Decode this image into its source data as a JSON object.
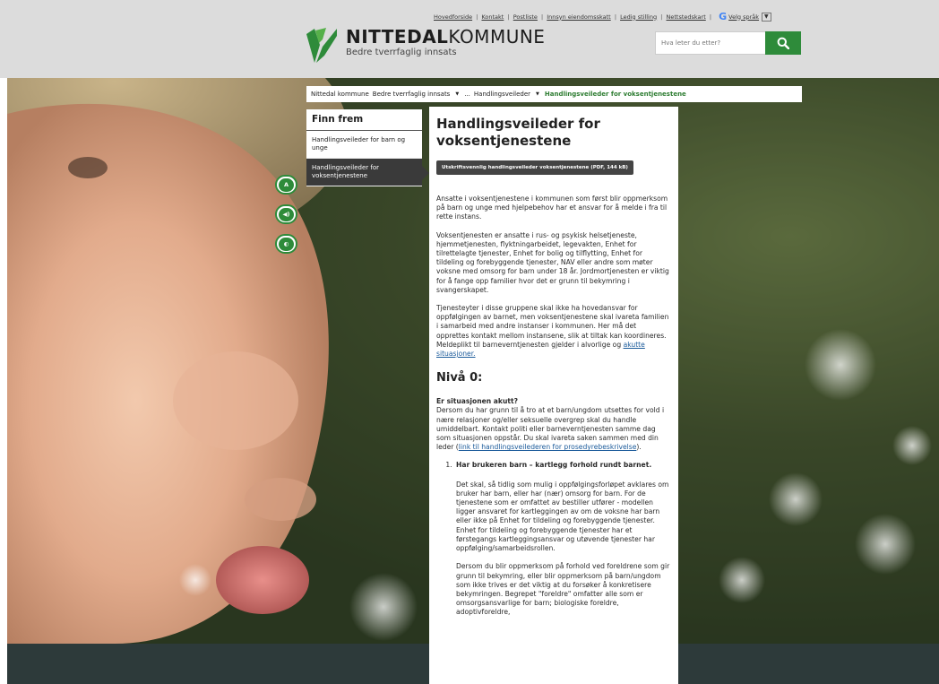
{
  "header": {
    "top_links": [
      "Hovedforside",
      "Kontakt",
      "Postliste",
      "Innsyn eiendomsskatt",
      "Ledig stilling",
      "Nettstedskart"
    ],
    "translate_label": "Velg språk",
    "translate_arrow": "▼",
    "brand_bold": "NITTEDAL",
    "brand_light": "KOMMUNE",
    "tagline": "Bedre tverrfaglig innsats",
    "search_placeholder": "Hva leter du etter?"
  },
  "breadcrumb": {
    "items": [
      "Nittedal kommune",
      "Bedre tverrfaglig innsats",
      "...",
      "Handlingsveileder"
    ],
    "current": "Handlingsveileder for voksentjenestene"
  },
  "sidenav": {
    "title": "Finn frem",
    "items": [
      "Handlingsveileder for barn og unge",
      "Handlingsveileder for voksentjenestene"
    ]
  },
  "tools": {
    "text_size": "A",
    "speaker": "◀)",
    "contrast": "◐"
  },
  "content": {
    "title": "Handlingsveileder for voksentjenestene",
    "pdf_button": "Utskriftsvennlig handlingsveileder voksentjenestene (PDF, 144 kB)",
    "p1": "Ansatte i voksentjenestene i kommunen som først blir oppmerksom på barn og unge med hjelpebehov har et ansvar for å melde i fra til rette instans.",
    "p2": "Voksentjenesten er ansatte i rus- og psykisk helsetjeneste, hjemmetjenesten, flyktningarbeidet, legevakten, Enhet for tilrettelagte tjenester, Enhet for bolig og tilflytting, Enhet for tildeling og forebyggende tjenester, NAV eller andre som møter voksne med omsorg for barn under 18 år. Jordmortjenesten er viktig for å fange opp familier hvor det er grunn til bekymring i svangerskapet.",
    "p3": "Tjenesteyter i disse gruppene skal ikke ha hovedansvar for oppfølgingen av barnet, men voksentjenestene skal ivareta familien i samarbeid med andre instanser i kommunen. Her må det opprettes kontakt mellom instansene, slik at tiltak kan koordineres. Meldeplikt til barneverntjenesten gjelder i alvorlige og",
    "p3_link": "akutte situasjoner.",
    "h2": "Nivå 0:",
    "sub": "Er situasjonen akutt?",
    "p4": "Dersom du har grunn til å tro at et barn/ungdom utsettes for vold i nære relasjoner og/eller seksuelle overgrep skal du handle umiddelbart. Kontakt politi eller barneverntjenesten samme dag som situasjonen oppstår. Du skal ivareta saken sammen med din leder (",
    "p4_link": "link til handlingsveilederen for prosedyrebeskrivelse",
    "p4_end": ").",
    "list_head": "Har brukeren barn – kartlegg forhold rundt barnet.",
    "list_p1": "Det skal, så tidlig som mulig i oppfølgingsforløpet avklares om bruker har barn, eller har (nær) omsorg for barn. For de tjenestene som er omfattet av bestiller utfører - modellen ligger ansvaret for kartleggingen av om de voksne har barn eller ikke på Enhet for tildeling og forebyggende tjenester. Enhet for tildeling og forebyggende tjenester har et førstegangs kartleggingsansvar og utøvende tjenester har oppfølging/samarbeidsrollen.",
    "list_p2": "Dersom du blir oppmerksom på forhold ved foreldrene som gir grunn til bekymring, eller blir oppmerksom på barn/ungdom som ikke trives er det viktig at du forsøker å konkretisere bekymringen. Begrepet \"foreldre\" omfatter alle som er omsorgsansvarlige for barn; biologiske foreldre, adoptivforeldre,"
  },
  "colors": {
    "brand_green": "#2e8b3a",
    "header_bg": "#dcdcdc",
    "footer": "#2d3a3a"
  }
}
